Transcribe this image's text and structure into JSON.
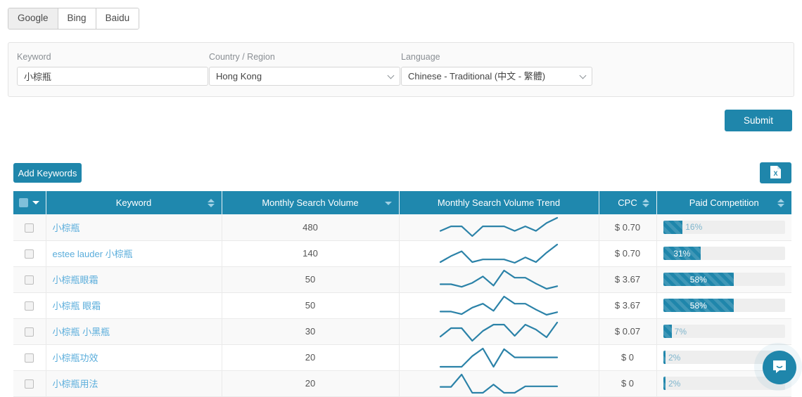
{
  "engine_tabs": [
    {
      "label": "Google",
      "active": true
    },
    {
      "label": "Bing",
      "active": false
    },
    {
      "label": "Baidu",
      "active": false
    }
  ],
  "form": {
    "keyword": {
      "label": "Keyword",
      "value": "小棕瓶",
      "placeholder": ""
    },
    "country": {
      "label": "Country / Region",
      "value": "Hong Kong"
    },
    "language": {
      "label": "Language",
      "value": "Chinese - Traditional (中文 - 繁體)"
    }
  },
  "actions": {
    "submit_label": "Submit",
    "add_keywords_label": "Add Keywords",
    "export_icon": "excel-file-icon"
  },
  "table": {
    "columns": [
      {
        "key": "check",
        "label": "",
        "sort": "none"
      },
      {
        "key": "keyword",
        "label": "Keyword",
        "sort": "both"
      },
      {
        "key": "volume",
        "label": "Monthly Search Volume",
        "sort": "desc"
      },
      {
        "key": "trend",
        "label": "Monthly Search Volume Trend",
        "sort": "none"
      },
      {
        "key": "cpc",
        "label": "CPC",
        "sort": "both"
      },
      {
        "key": "competition",
        "label": "Paid Competition",
        "sort": "both"
      }
    ],
    "rows": [
      {
        "keyword": "小棕瓶",
        "volume": "480",
        "cpc": "$ 0.70",
        "competition_pct": 16,
        "competition_label": "16%",
        "trend": [
          38,
          52,
          52,
          22,
          52,
          52,
          52,
          38,
          52,
          38,
          62,
          78
        ]
      },
      {
        "keyword": "estee lauder 小棕瓶",
        "volume": "140",
        "cpc": "$ 0.70",
        "competition_pct": 31,
        "competition_label": "31%",
        "trend": [
          30,
          48,
          62,
          30,
          38,
          38,
          38,
          28,
          44,
          30,
          58,
          82
        ]
      },
      {
        "keyword": "小棕瓶眼霜",
        "volume": "50",
        "cpc": "$ 3.67",
        "competition_pct": 58,
        "competition_label": "58%",
        "trend": [
          42,
          42,
          34,
          46,
          66,
          38,
          84,
          62,
          62,
          44,
          28,
          36
        ]
      },
      {
        "keyword": "小棕瓶 眼霜",
        "volume": "50",
        "cpc": "$ 3.67",
        "competition_pct": 58,
        "competition_label": "58%",
        "trend": [
          38,
          38,
          30,
          50,
          62,
          40,
          84,
          62,
          62,
          44,
          28,
          36
        ]
      },
      {
        "keyword": "小棕瓶 小黑瓶",
        "volume": "30",
        "cpc": "$ 0.07",
        "competition_pct": 7,
        "competition_label": "7%",
        "trend": [
          32,
          56,
          56,
          20,
          48,
          66,
          66,
          34,
          66,
          52,
          30,
          72
        ]
      },
      {
        "keyword": "小棕瓶功效",
        "volume": "20",
        "cpc": "$ 0",
        "competition_pct": 2,
        "competition_label": "2%",
        "trend": [
          22,
          22,
          22,
          56,
          80,
          22,
          78,
          52,
          52,
          52,
          52,
          52
        ]
      },
      {
        "keyword": "小棕瓶用法",
        "volume": "20",
        "cpc": "$ 0",
        "competition_pct": 2,
        "competition_label": "2%",
        "trend": [
          38,
          38,
          80,
          18,
          18,
          46,
          18,
          18,
          40,
          40,
          40,
          40
        ]
      }
    ]
  },
  "chat": {
    "icon": "chat-bubble-icon"
  },
  "colors": {
    "brand": "#1f86ab",
    "header": "#1f88ae",
    "link": "#5aaddb",
    "track": "#eeeeee",
    "sparkline": "#2b82a8"
  }
}
